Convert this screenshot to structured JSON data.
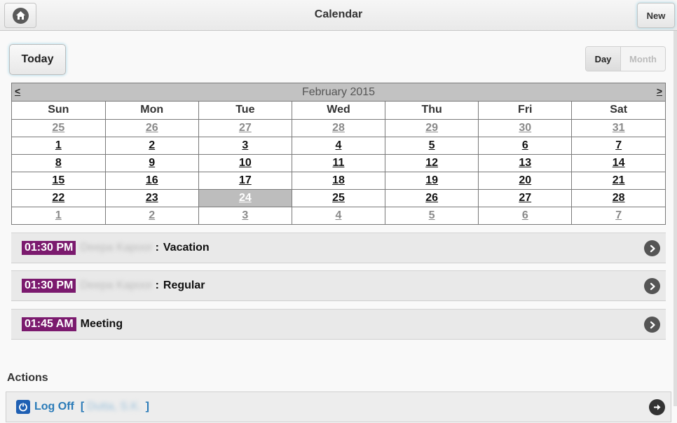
{
  "header": {
    "title": "Calendar",
    "new_label": "New"
  },
  "controls": {
    "today_label": "Today",
    "day_label": "Day",
    "month_label": "Month"
  },
  "calendar": {
    "prev": "<",
    "next": ">",
    "month": "February 2015",
    "weekdays": [
      "Sun",
      "Mon",
      "Tue",
      "Wed",
      "Thu",
      "Fri",
      "Sat"
    ],
    "weeks": [
      [
        [
          "25",
          "other"
        ],
        [
          "26",
          "other"
        ],
        [
          "27",
          "other"
        ],
        [
          "28",
          "other"
        ],
        [
          "29",
          "other"
        ],
        [
          "30",
          "other"
        ],
        [
          "31",
          "other"
        ]
      ],
      [
        [
          "1",
          ""
        ],
        [
          "2",
          ""
        ],
        [
          "3",
          ""
        ],
        [
          "4",
          ""
        ],
        [
          "5",
          ""
        ],
        [
          "6",
          ""
        ],
        [
          "7",
          ""
        ]
      ],
      [
        [
          "8",
          ""
        ],
        [
          "9",
          ""
        ],
        [
          "10",
          ""
        ],
        [
          "11",
          ""
        ],
        [
          "12",
          ""
        ],
        [
          "13",
          ""
        ],
        [
          "14",
          ""
        ]
      ],
      [
        [
          "15",
          ""
        ],
        [
          "16",
          ""
        ],
        [
          "17",
          ""
        ],
        [
          "18",
          ""
        ],
        [
          "19",
          ""
        ],
        [
          "20",
          ""
        ],
        [
          "21",
          ""
        ]
      ],
      [
        [
          "22",
          ""
        ],
        [
          "23",
          ""
        ],
        [
          "24",
          "today"
        ],
        [
          "25",
          ""
        ],
        [
          "26",
          ""
        ],
        [
          "27",
          ""
        ],
        [
          "28",
          ""
        ]
      ],
      [
        [
          "1",
          "other"
        ],
        [
          "2",
          "other"
        ],
        [
          "3",
          "other"
        ],
        [
          "4",
          "other"
        ],
        [
          "5",
          "other"
        ],
        [
          "6",
          "other"
        ],
        [
          "7",
          "other"
        ]
      ]
    ]
  },
  "events": [
    {
      "time": "01:30 PM",
      "person": "Deepa Kapoor",
      "sep": ":",
      "title": "Vacation"
    },
    {
      "time": "01:30 PM",
      "person": "Deepa Kapoor",
      "sep": ":",
      "title": "Regular"
    },
    {
      "time": "01:45 AM",
      "person": "",
      "sep": "",
      "title": "Meeting"
    }
  ],
  "actions": {
    "label": "Actions",
    "logoff_label": "Log Off",
    "bracket_open": "[",
    "user": "Dutta, S.K.",
    "bracket_close": "]"
  },
  "colors": {
    "time_badge": "#7b1a6e",
    "link_blue": "#2a7bb8",
    "today_cell": "#bdbdbd",
    "cal_header": "#c2c2c2"
  },
  "icons": {
    "home": "home-icon",
    "event_arrow": "chevron-right-circle-icon",
    "logoff": "power-icon",
    "logoff_arrow": "arrow-right-circle-icon"
  }
}
